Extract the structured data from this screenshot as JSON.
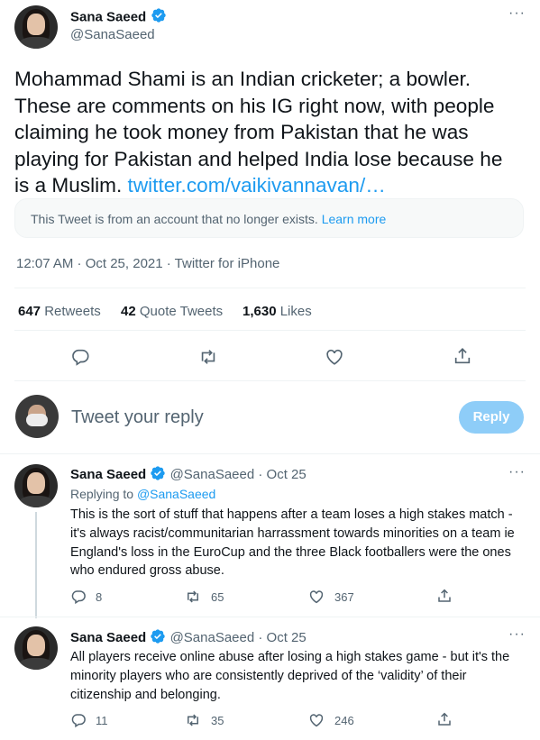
{
  "main_tweet": {
    "author_name": "Sana Saeed",
    "author_handle": "@SanaSaeed",
    "more": "···",
    "text": "Mohammad Shami is an Indian cricketer; a bowler. These are comments on his IG right now, with people claiming he took money from Pakistan that he was playing for Pakistan and helped India lose because he is a Muslim.",
    "link": "twitter.com/vaikivannavan/…",
    "quote_notice": "This Tweet is from an account that no longer exists.",
    "learn_more": "Learn more",
    "timestamp": "12:07 AM · Oct 25, 2021 · Twitter for iPhone",
    "stats": {
      "retweets_count": "647",
      "retweets_label": "Retweets",
      "quotes_count": "42",
      "quotes_label": "Quote Tweets",
      "likes_count": "1,630",
      "likes_label": "Likes"
    }
  },
  "reply_box": {
    "placeholder": "Tweet your reply",
    "button": "Reply"
  },
  "replies": [
    {
      "author_name": "Sana Saeed",
      "author_handle": "@SanaSaeed",
      "date": "· Oct 25",
      "replying_prefix": "Replying to",
      "replying_to": "@SanaSaeed",
      "text": "This is the sort of stuff that happens after a team loses a high stakes match - it's always racist/communitarian harrassment towards minorities on a team ie England's loss in the EuroCup and the three Black footballers were the ones who endured gross abuse.",
      "replies": "8",
      "retweets": "65",
      "likes": "367"
    },
    {
      "author_name": "Sana Saeed",
      "author_handle": "@SanaSaeed",
      "date": "· Oct 25",
      "text": "All players receive online abuse after losing a high stakes game - but it's the minority players who are consistently deprived of the ‘validity’ of their citizenship and belonging.",
      "replies": "11",
      "retweets": "35",
      "likes": "246"
    }
  ],
  "colors": {
    "accent": "#1d9bf0",
    "muted": "#536471",
    "reply_button_disabled": "#8ecdf8"
  }
}
